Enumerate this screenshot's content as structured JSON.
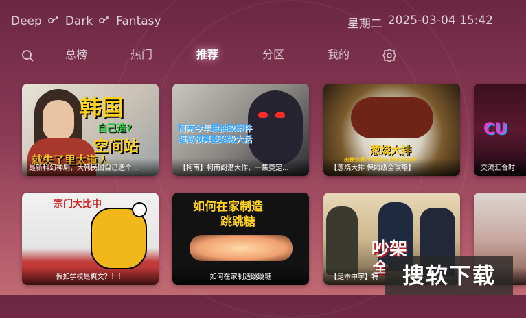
{
  "breadcrumb": {
    "items": [
      "Deep",
      "Dark",
      "Fantasy"
    ],
    "link_icon": "link-icon"
  },
  "clock": {
    "weekday": "星期二",
    "datetime": "2025-03-04 15:42"
  },
  "nav": {
    "search_icon": "search-icon",
    "settings_icon": "gear-icon",
    "tabs": [
      "总榜",
      "热门",
      "推荐",
      "分区",
      "我的"
    ],
    "active_tab": "推荐"
  },
  "cards": [
    {
      "caption": "最新科幻神剧，大韩民国自己造个...",
      "title_big": "韩国",
      "title_sub": "自己造?",
      "title_sub2": "空间站",
      "title_bottom": "就失了里太道人"
    },
    {
      "caption": "【柯南】柯南阁潜大作，一集奠定...",
      "title_line1": "柯南今年最抽象案件",
      "title_line2": "超高预算整超级大活"
    },
    {
      "caption": "【葱烧大排 保姆级全攻略】",
      "title_big": "葱烧大排",
      "title_small": "肉嫩的都不像猪肉  酱汁超好吃"
    },
    {
      "caption": "交流汇合时",
      "title_big": "CU"
    },
    {
      "caption": "假如学校是爽文？！！",
      "title_big": "宗门大比中"
    },
    {
      "caption": "如何在家制造跳跳糖",
      "title_line1": "如何在家制造",
      "title_line2": "跳跳糖"
    },
    {
      "caption": "【足本中字】特",
      "title_big": "吵架",
      "title_big2": "全"
    },
    {
      "caption": ""
    }
  ],
  "watermark": {
    "text": "搜软下载"
  },
  "colors": {
    "bg_top": "#6b2742",
    "bg_bottom": "#c06a72",
    "yellow": "#ffd21e"
  }
}
